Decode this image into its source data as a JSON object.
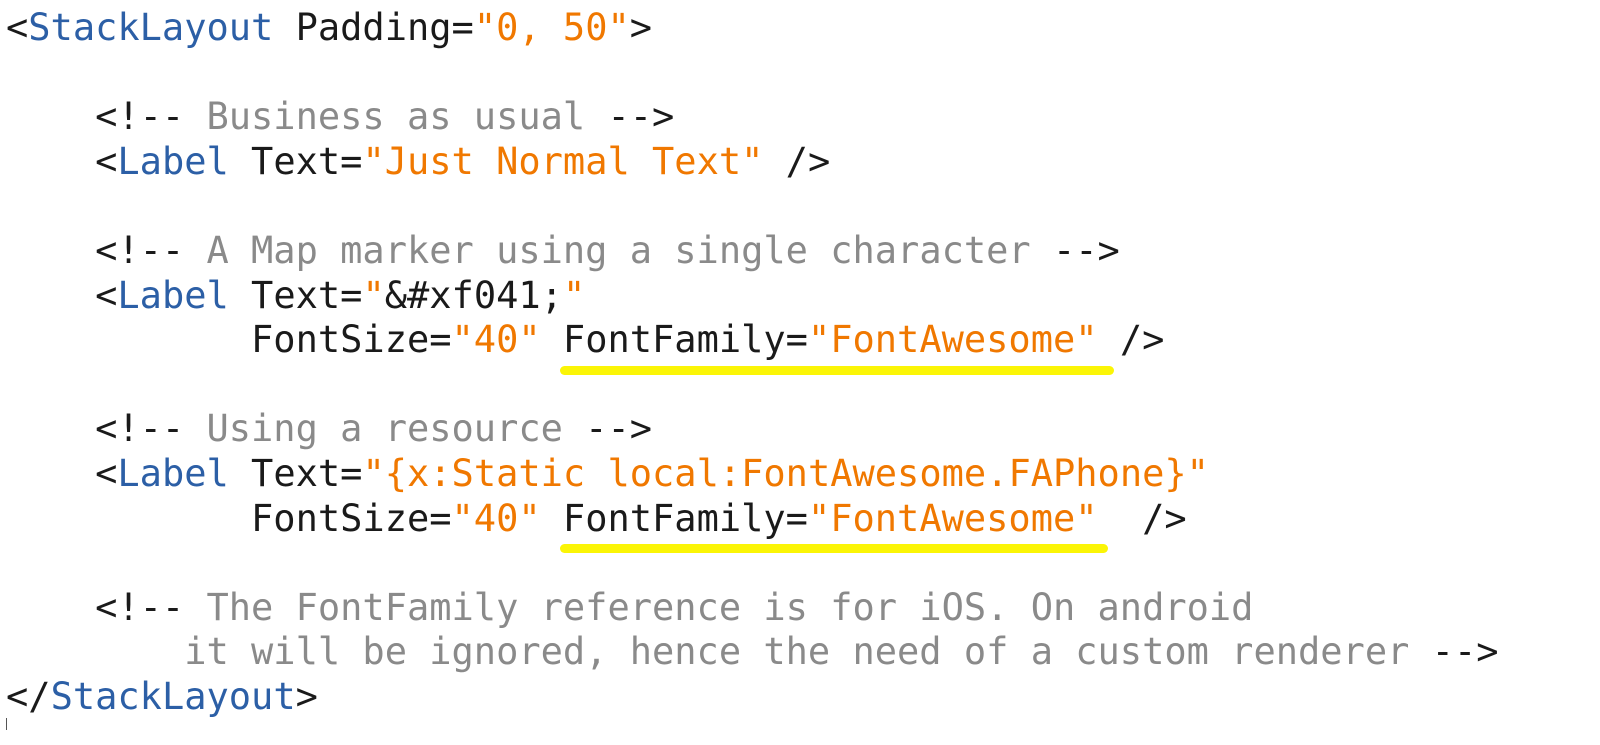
{
  "code_lines": [
    {
      "id": "stacklayout-open",
      "tokens": [
        {
          "t": "punct",
          "v": "<"
        },
        {
          "t": "tag",
          "v": "StackLayout"
        },
        {
          "t": "attr",
          "v": " Padding="
        },
        {
          "t": "str",
          "v": "\"0, 50\""
        },
        {
          "t": "punct",
          "v": ">"
        }
      ]
    },
    {
      "id": "blank-1",
      "tokens": []
    },
    {
      "id": "comment-business",
      "tokens": [
        {
          "t": "punct",
          "v": "    <!-- "
        },
        {
          "t": "com",
          "v": "Business as usual"
        },
        {
          "t": "punct",
          "v": " -->"
        }
      ]
    },
    {
      "id": "label-normal-text",
      "tokens": [
        {
          "t": "punct",
          "v": "    <"
        },
        {
          "t": "tag",
          "v": "Label"
        },
        {
          "t": "attr",
          "v": " Text="
        },
        {
          "t": "str",
          "v": "\"Just Normal Text\""
        },
        {
          "t": "punct",
          "v": " />"
        }
      ]
    },
    {
      "id": "blank-2",
      "tokens": []
    },
    {
      "id": "comment-map-marker",
      "tokens": [
        {
          "t": "punct",
          "v": "    <!-- "
        },
        {
          "t": "com",
          "v": "A Map marker using a single character"
        },
        {
          "t": "punct",
          "v": " -->"
        }
      ]
    },
    {
      "id": "label-map-marker",
      "tokens": [
        {
          "t": "punct",
          "v": "    <"
        },
        {
          "t": "tag",
          "v": "Label"
        },
        {
          "t": "attr",
          "v": " Text="
        },
        {
          "t": "str",
          "v": "\""
        },
        {
          "t": "punct",
          "v": "&#xf041;"
        },
        {
          "t": "str",
          "v": "\""
        }
      ]
    },
    {
      "id": "label-map-marker-font",
      "tokens": [
        {
          "t": "attr",
          "v": "           FontSize="
        },
        {
          "t": "str",
          "v": "\"40\""
        },
        {
          "t": "attr",
          "v": " FontFamily="
        },
        {
          "t": "str",
          "v": "\"FontAwesome\""
        },
        {
          "t": "punct",
          "v": " />"
        }
      ]
    },
    {
      "id": "blank-3",
      "tokens": []
    },
    {
      "id": "comment-resource",
      "tokens": [
        {
          "t": "punct",
          "v": "    <!-- "
        },
        {
          "t": "com",
          "v": "Using a resource"
        },
        {
          "t": "punct",
          "v": " -->"
        }
      ]
    },
    {
      "id": "label-resource",
      "tokens": [
        {
          "t": "punct",
          "v": "    <"
        },
        {
          "t": "tag",
          "v": "Label"
        },
        {
          "t": "attr",
          "v": " Text="
        },
        {
          "t": "str",
          "v": "\"{x:Static local:FontAwesome.FAPhone}\""
        }
      ]
    },
    {
      "id": "label-resource-font",
      "tokens": [
        {
          "t": "attr",
          "v": "           FontSize="
        },
        {
          "t": "str",
          "v": "\"40\""
        },
        {
          "t": "attr",
          "v": " FontFamily="
        },
        {
          "t": "str",
          "v": "\"FontAwesome\""
        },
        {
          "t": "punct",
          "v": "  />"
        }
      ]
    },
    {
      "id": "blank-4",
      "tokens": []
    },
    {
      "id": "comment-ios-1",
      "tokens": [
        {
          "t": "punct",
          "v": "    <!-- "
        },
        {
          "t": "com",
          "v": "The FontFamily reference is for iOS. On android"
        }
      ]
    },
    {
      "id": "comment-ios-2",
      "tokens": [
        {
          "t": "com",
          "v": "        it will be ignored, hence the need of a custom renderer"
        },
        {
          "t": "punct",
          "v": " -->"
        }
      ]
    },
    {
      "id": "stacklayout-close",
      "tokens": [
        {
          "t": "punct",
          "v": "</"
        },
        {
          "t": "tag",
          "v": "StackLayout"
        },
        {
          "t": "punct",
          "v": ">"
        }
      ]
    }
  ],
  "highlights": [
    {
      "name": "highlight-fontfamily-map-marker",
      "color": "#fbf506"
    },
    {
      "name": "highlight-fontfamily-resource",
      "color": "#fbf506"
    }
  ],
  "colors": {
    "tag": "#2c5fa6",
    "attr": "#1a1a1a",
    "string": "#f07800",
    "comment": "#8a8a8a",
    "punct": "#1a1a1a",
    "highlight": "#fbf506"
  }
}
